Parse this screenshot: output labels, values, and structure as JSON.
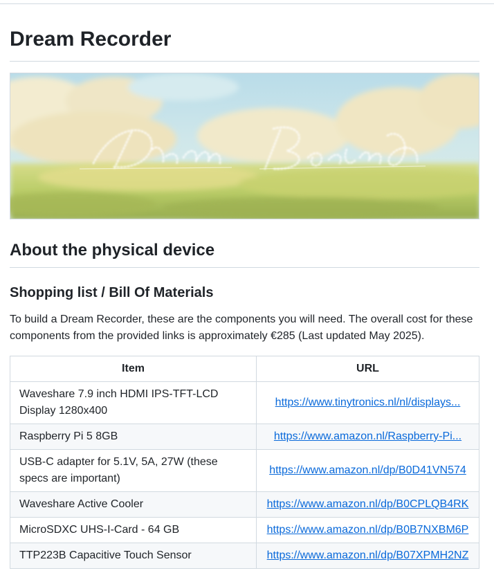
{
  "page": {
    "title": "Dream Recorder",
    "banner": {
      "icon": "dream-recorder-banner-image",
      "script_text": "Dream Recorder"
    },
    "section_heading": "About the physical device",
    "subsection_heading": "Shopping list / Bill Of Materials",
    "intro_text": "To build a Dream Recorder, these are the components you will need. The overall cost for these components from the provided links is approximately €285 (Last updated May 2025).",
    "colors": {
      "link": "#0969da",
      "border": "#d1d9e0",
      "alt_row": "#f6f8fa"
    }
  },
  "table": {
    "headers": {
      "item": "Item",
      "url": "URL"
    },
    "rows": [
      {
        "item": "Waveshare 7.9 inch HDMI IPS-TFT-LCD Display 1280x400",
        "url": "https://www.tinytronics.nl/nl/displays..."
      },
      {
        "item": "Raspberry Pi 5 8GB",
        "url": "https://www.amazon.nl/Raspberry-Pi..."
      },
      {
        "item": "USB-C adapter for 5.1V, 5A, 27W (these specs are important)",
        "url": "https://www.amazon.nl/dp/B0D41VN574"
      },
      {
        "item": "Waveshare Active Cooler",
        "url": "https://www.amazon.nl/dp/B0CPLQB4RK"
      },
      {
        "item": "MicroSDXC UHS-I-Card - 64 GB",
        "url": "https://www.amazon.nl/dp/B0B7NXBM6P"
      },
      {
        "item": "TTP223B Capacitive Touch Sensor",
        "url": "https://www.amazon.nl/dp/B07XPMH2NZ"
      }
    ]
  }
}
